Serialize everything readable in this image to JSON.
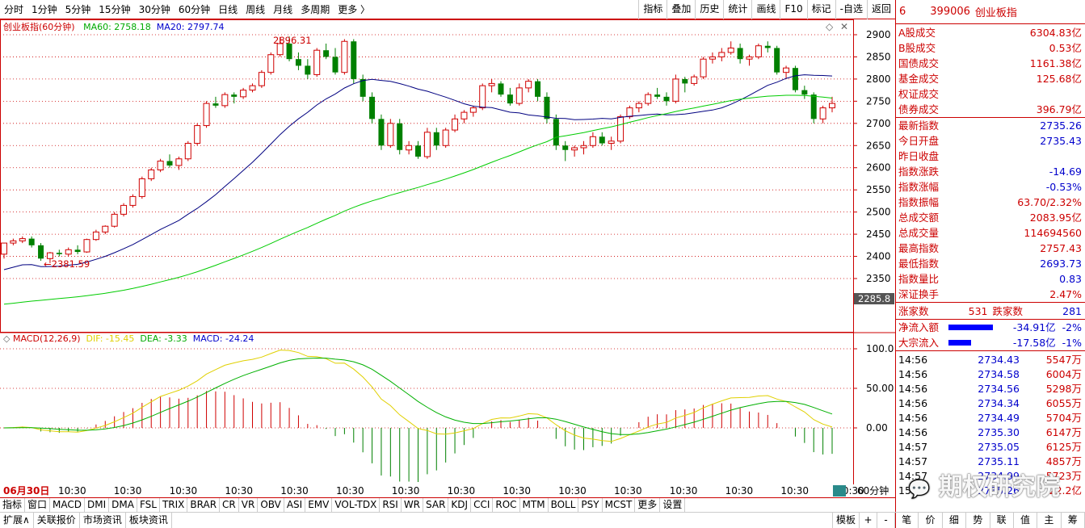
{
  "toolbar": {
    "periods": [
      "分时",
      "1分钟",
      "5分钟",
      "15分钟",
      "30分钟",
      "60分钟",
      "日线",
      "周线",
      "月线",
      "多周期",
      "更多 〉"
    ],
    "right_buttons": [
      "指标",
      "叠加",
      "历史",
      "统计",
      "画线",
      "F10",
      "标记",
      "-自选",
      "返回"
    ]
  },
  "main_chart": {
    "title": "创业板指(60分钟)",
    "ma60_label": "MA60: 2758.18",
    "ma20_label": "MA20: 2797.74",
    "high_marker": "2896.31",
    "low_marker": "←2381.59",
    "last_price_tag": "2285.8",
    "y_ticks": [
      "2900",
      "2850",
      "2800",
      "2750",
      "2700",
      "2650",
      "2600",
      "2550",
      "2500",
      "2450",
      "2400",
      "2350"
    ],
    "y_range": [
      2285,
      2915
    ],
    "colors": {
      "up": "#d00000",
      "down": "#008000",
      "ma20": "#000080",
      "ma60": "#00cc00",
      "dif": "#e0d000",
      "dea": "#00b000"
    }
  },
  "macd": {
    "title": "MACD(12,26,9)",
    "dif": "DIF: -15.45",
    "dea": "DEA: -3.33",
    "macd": "MACD: -24.24",
    "y_ticks": [
      "100.0",
      "50.00",
      "0.00"
    ]
  },
  "xaxis": {
    "date": "06月30日",
    "ticks": [
      "10:30",
      "10:30",
      "10:30",
      "10:30",
      "10:30",
      "10:30",
      "10:30",
      "10:30",
      "10:30",
      "10:30",
      "10:30",
      "10:30",
      "10:30",
      "10:30",
      "10:30"
    ],
    "period": "60分钟"
  },
  "chart_data": {
    "type": "candlestick",
    "ylim": [
      2285,
      2915
    ],
    "candles": [
      [
        2405,
        2430,
        2395,
        2430
      ],
      [
        2430,
        2440,
        2425,
        2435
      ],
      [
        2435,
        2445,
        2430,
        2440
      ],
      [
        2440,
        2445,
        2420,
        2425
      ],
      [
        2425,
        2430,
        2390,
        2395
      ],
      [
        2395,
        2410,
        2385,
        2408
      ],
      [
        2408,
        2415,
        2400,
        2405
      ],
      [
        2405,
        2420,
        2400,
        2415
      ],
      [
        2415,
        2425,
        2405,
        2410
      ],
      [
        2410,
        2440,
        2408,
        2438
      ],
      [
        2438,
        2460,
        2435,
        2455
      ],
      [
        2455,
        2470,
        2450,
        2468
      ],
      [
        2468,
        2500,
        2465,
        2495
      ],
      [
        2495,
        2520,
        2490,
        2515
      ],
      [
        2515,
        2540,
        2510,
        2535
      ],
      [
        2535,
        2580,
        2530,
        2575
      ],
      [
        2575,
        2600,
        2570,
        2595
      ],
      [
        2595,
        2620,
        2590,
        2615
      ],
      [
        2615,
        2630,
        2600,
        2605
      ],
      [
        2605,
        2625,
        2595,
        2620
      ],
      [
        2620,
        2660,
        2615,
        2655
      ],
      [
        2655,
        2700,
        2650,
        2695
      ],
      [
        2695,
        2750,
        2690,
        2745
      ],
      [
        2745,
        2760,
        2735,
        2740
      ],
      [
        2740,
        2770,
        2735,
        2765
      ],
      [
        2765,
        2770,
        2745,
        2760
      ],
      [
        2760,
        2780,
        2755,
        2775
      ],
      [
        2775,
        2790,
        2770,
        2785
      ],
      [
        2785,
        2820,
        2780,
        2815
      ],
      [
        2815,
        2860,
        2810,
        2855
      ],
      [
        2855,
        2895,
        2850,
        2880
      ],
      [
        2880,
        2896,
        2840,
        2845
      ],
      [
        2845,
        2860,
        2820,
        2830
      ],
      [
        2830,
        2845,
        2800,
        2810
      ],
      [
        2810,
        2870,
        2805,
        2865
      ],
      [
        2865,
        2880,
        2845,
        2850
      ],
      [
        2850,
        2870,
        2810,
        2815
      ],
      [
        2815,
        2890,
        2810,
        2885
      ],
      [
        2885,
        2890,
        2790,
        2800
      ],
      [
        2800,
        2810,
        2750,
        2760
      ],
      [
        2760,
        2770,
        2700,
        2710
      ],
      [
        2710,
        2720,
        2640,
        2650
      ],
      [
        2650,
        2710,
        2645,
        2700
      ],
      [
        2700,
        2710,
        2630,
        2640
      ],
      [
        2640,
        2660,
        2630,
        2650
      ],
      [
        2650,
        2660,
        2620,
        2625
      ],
      [
        2625,
        2690,
        2620,
        2680
      ],
      [
        2680,
        2690,
        2640,
        2650
      ],
      [
        2650,
        2690,
        2645,
        2685
      ],
      [
        2685,
        2720,
        2680,
        2710
      ],
      [
        2710,
        2730,
        2700,
        2725
      ],
      [
        2725,
        2740,
        2715,
        2735
      ],
      [
        2735,
        2790,
        2730,
        2785
      ],
      [
        2785,
        2800,
        2770,
        2790
      ],
      [
        2790,
        2795,
        2760,
        2765
      ],
      [
        2765,
        2780,
        2740,
        2745
      ],
      [
        2745,
        2790,
        2740,
        2780
      ],
      [
        2780,
        2800,
        2770,
        2795
      ],
      [
        2795,
        2800,
        2750,
        2760
      ],
      [
        2760,
        2770,
        2700,
        2710
      ],
      [
        2710,
        2720,
        2640,
        2650
      ],
      [
        2650,
        2660,
        2615,
        2640
      ],
      [
        2640,
        2650,
        2625,
        2645
      ],
      [
        2645,
        2660,
        2630,
        2650
      ],
      [
        2650,
        2680,
        2645,
        2670
      ],
      [
        2670,
        2680,
        2650,
        2655
      ],
      [
        2655,
        2670,
        2640,
        2660
      ],
      [
        2660,
        2720,
        2655,
        2715
      ],
      [
        2715,
        2740,
        2710,
        2735
      ],
      [
        2735,
        2750,
        2725,
        2745
      ],
      [
        2745,
        2770,
        2740,
        2765
      ],
      [
        2765,
        2780,
        2755,
        2760
      ],
      [
        2760,
        2770,
        2740,
        2750
      ],
      [
        2750,
        2810,
        2745,
        2800
      ],
      [
        2800,
        2805,
        2770,
        2790
      ],
      [
        2790,
        2810,
        2785,
        2805
      ],
      [
        2805,
        2850,
        2800,
        2845
      ],
      [
        2845,
        2860,
        2835,
        2850
      ],
      [
        2850,
        2870,
        2840,
        2860
      ],
      [
        2860,
        2885,
        2855,
        2870
      ],
      [
        2870,
        2880,
        2835,
        2845
      ],
      [
        2845,
        2855,
        2830,
        2850
      ],
      [
        2850,
        2880,
        2845,
        2875
      ],
      [
        2875,
        2885,
        2860,
        2870
      ],
      [
        2870,
        2875,
        2810,
        2815
      ],
      [
        2815,
        2830,
        2800,
        2825
      ],
      [
        2825,
        2830,
        2770,
        2775
      ],
      [
        2775,
        2785,
        2755,
        2765
      ],
      [
        2765,
        2770,
        2700,
        2710
      ],
      [
        2710,
        2740,
        2700,
        2735
      ],
      [
        2735,
        2760,
        2725,
        2745
      ]
    ],
    "high": 2896.31,
    "low": 2381.59
  },
  "right_panel": {
    "code": "399006",
    "name": "创业板指",
    "prefix": "6",
    "block1": [
      {
        "l": "A股成交",
        "v": "6304.83亿",
        "c": "r"
      },
      {
        "l": "B股成交",
        "v": "0.53亿",
        "c": "r"
      },
      {
        "l": "国债成交",
        "v": "1161.38亿",
        "c": "r"
      },
      {
        "l": "基金成交",
        "v": "125.68亿",
        "c": "r"
      },
      {
        "l": "权证成交",
        "v": "",
        "c": "r"
      },
      {
        "l": "债券成交",
        "v": "396.79亿",
        "c": "r"
      }
    ],
    "block2": [
      {
        "l": "最新指数",
        "v": "2735.26",
        "c": "b"
      },
      {
        "l": "今日开盘",
        "v": "2735.43",
        "c": "b"
      },
      {
        "l": "昨日收盘",
        "v": "",
        "c": "r"
      },
      {
        "l": "指数涨跌",
        "v": "-14.69",
        "c": "b"
      },
      {
        "l": "指数涨幅",
        "v": "-0.53%",
        "c": "b"
      },
      {
        "l": "指数振幅",
        "v": "63.70/2.32%",
        "c": "r"
      },
      {
        "l": "总成交额",
        "v": "2083.95亿",
        "c": "r"
      },
      {
        "l": "总成交量",
        "v": "114694560",
        "c": "r"
      },
      {
        "l": "最高指数",
        "v": "2757.43",
        "c": "r"
      },
      {
        "l": "最低指数",
        "v": "2693.73",
        "c": "b"
      },
      {
        "l": "指数量比",
        "v": "0.83",
        "c": "b"
      },
      {
        "l": "深证换手",
        "v": "2.47%",
        "c": "r"
      }
    ],
    "updown": {
      "up_label": "涨家数",
      "up": "531",
      "down_label": "跌家数",
      "down": "281"
    },
    "flows": [
      {
        "l": "净流入额",
        "v": "-34.91亿",
        "p": "-2%",
        "w": 55
      },
      {
        "l": "大宗流入",
        "v": "-17.58亿",
        "p": "-1%",
        "w": 28
      }
    ],
    "ticks": [
      {
        "t": "14:56",
        "p": "2734.43",
        "v": "5547万"
      },
      {
        "t": "14:56",
        "p": "2734.58",
        "v": "6004万"
      },
      {
        "t": "14:56",
        "p": "2734.56",
        "v": "5298万"
      },
      {
        "t": "14:56",
        "p": "2734.34",
        "v": "6055万"
      },
      {
        "t": "14:56",
        "p": "2734.49",
        "v": "5704万"
      },
      {
        "t": "14:56",
        "p": "2735.30",
        "v": "6147万"
      },
      {
        "t": "14:57",
        "p": "2735.05",
        "v": "6125万"
      },
      {
        "t": "14:57",
        "p": "2735.11",
        "v": "4857万"
      },
      {
        "t": "14:57",
        "p": "2734.99",
        "v": "5723万"
      },
      {
        "t": "15:00",
        "p": "2735.26",
        "v": "22.2亿"
      }
    ],
    "bottom_tabs": [
      "笔",
      "价",
      "细",
      "势",
      "联",
      "值",
      "主",
      "筹"
    ]
  },
  "bottom": {
    "indicators": [
      "指标",
      "窗口",
      "MACD",
      "DMI",
      "DMA",
      "FSL",
      "TRIX",
      "BRAR",
      "CR",
      "VR",
      "OBV",
      "ASI",
      "EMV",
      "VOL-TDX",
      "RSI",
      "WR",
      "SAR",
      "KDJ",
      "CCI",
      "ROC",
      "MTM",
      "BOLL",
      "PSY",
      "MCST",
      "更多",
      "设置"
    ],
    "tabs": [
      "扩展∧",
      "关联报价",
      "市场资讯",
      "板块资讯"
    ],
    "right": [
      "模板",
      "+",
      "-"
    ]
  },
  "watermark": "期权研究院"
}
